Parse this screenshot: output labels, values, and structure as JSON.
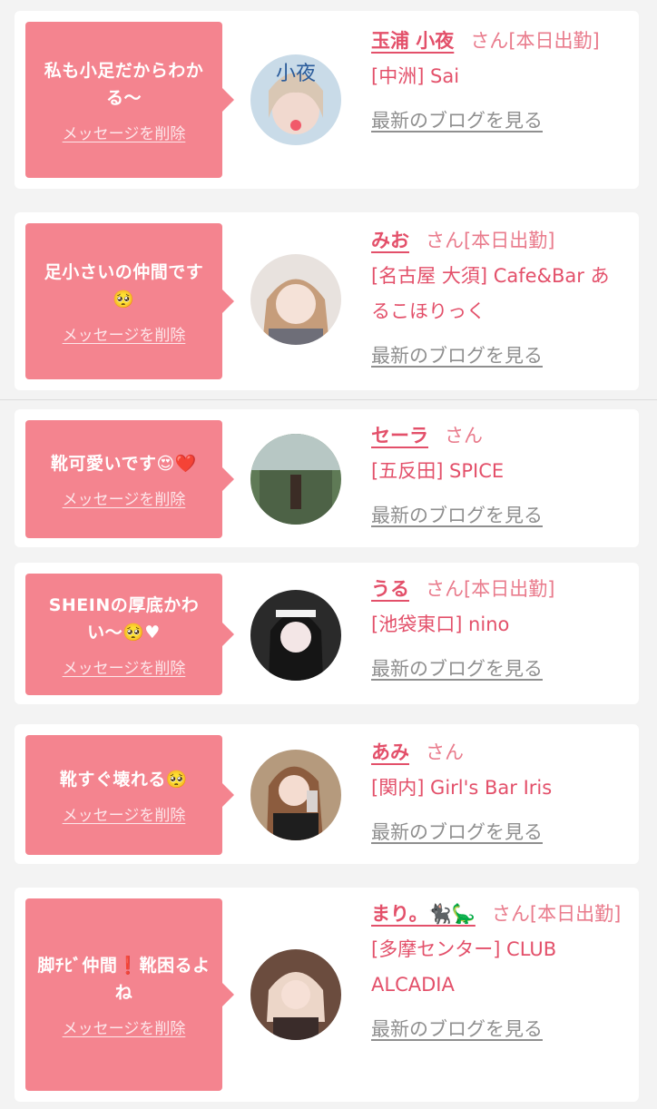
{
  "entries": [
    {
      "message": "私も小足だからわかる〜",
      "delete_label": "メッセージを削除",
      "name": "玉浦 小夜",
      "honorific": "さん",
      "status": "[本日出勤]",
      "shop": "[中洲] Sai",
      "blog_link": "最新のブログを見る",
      "avatar_icon": "profile-photo",
      "avatar_text": "小夜"
    },
    {
      "message": "足小さいの仲間です🥺",
      "delete_label": "メッセージを削除",
      "name": "みお",
      "honorific": "さん",
      "status": "[本日出勤]",
      "shop": "[名古屋 大須] Cafe&Bar あるこほりっく",
      "blog_link": "最新のブログを見る",
      "avatar_icon": "profile-photo"
    },
    {
      "message": "靴可愛いです😍❤️",
      "delete_label": "メッセージを削除",
      "name": "セーラ",
      "honorific": "さん",
      "status": "",
      "shop": "[五反田] SPICE",
      "blog_link": "最新のブログを見る",
      "avatar_icon": "profile-photo"
    },
    {
      "message": "SHEINの厚底かわい〜🥺♥",
      "delete_label": "メッセージを削除",
      "name": "うる",
      "honorific": "さん",
      "status": "[本日出勤]",
      "shop": "[池袋東口] nino",
      "blog_link": "最新のブログを見る",
      "avatar_icon": "profile-photo"
    },
    {
      "message": "靴すぐ壊れる🥺",
      "delete_label": "メッセージを削除",
      "name": "あみ",
      "honorific": "さん",
      "status": "",
      "shop": "[関内] Girl's Bar Iris",
      "blog_link": "最新のブログを見る",
      "avatar_icon": "profile-photo"
    },
    {
      "message": "脚ﾁﾋﾞ仲間❗️靴困るよね",
      "delete_label": "メッセージを削除",
      "name": "まり。🐈‍⬛🦕",
      "honorific": "さん",
      "status": "[本日出勤]",
      "shop": "[多摩センター] CLUB ALCADIA",
      "blog_link": "最新のブログを見る",
      "avatar_icon": "profile-photo"
    }
  ],
  "colors": {
    "bubble": "#f4848f",
    "name": "#e3506a",
    "link_gray": "#8f8f8f",
    "background": "#f3f3f3"
  }
}
